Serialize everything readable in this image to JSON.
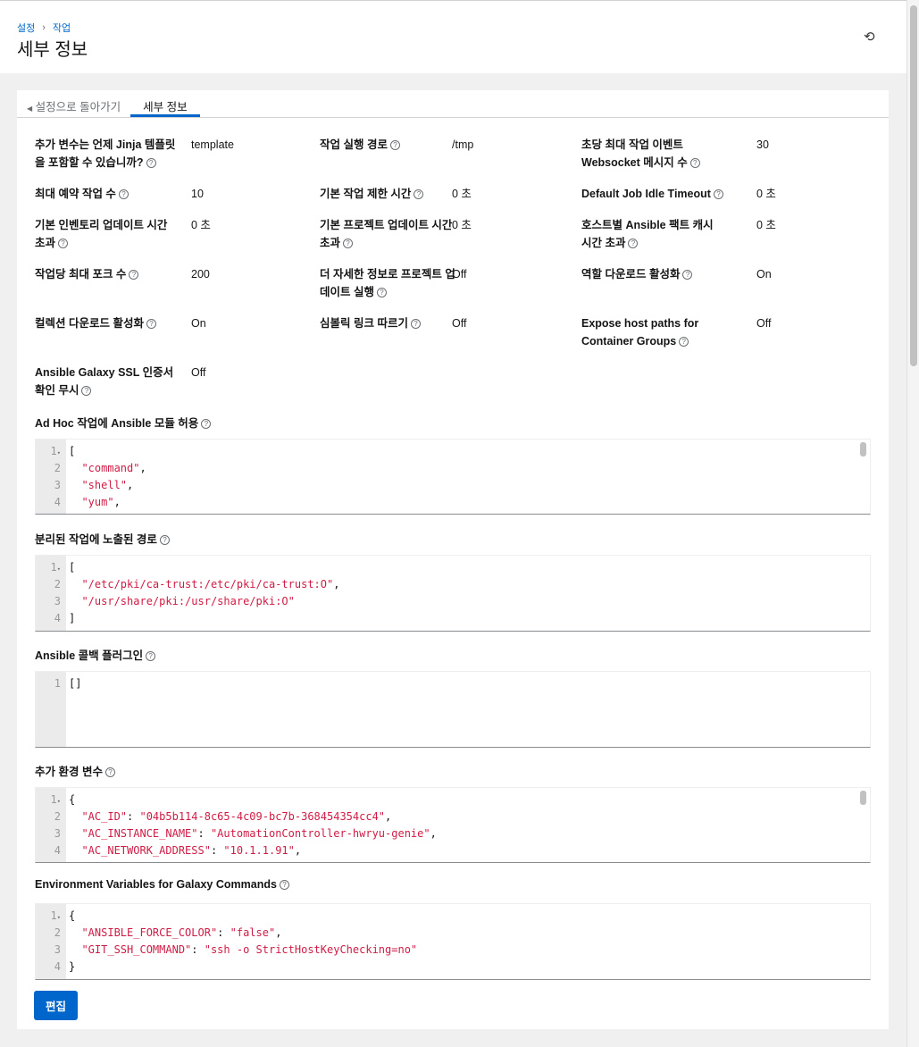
{
  "breadcrumb": [
    "설정",
    "작업"
  ],
  "title": "세부 정보",
  "tabs": {
    "back": "설정으로 돌아가기",
    "details": "세부 정보"
  },
  "fields": [
    {
      "label": "추가 변수는 언제 Jinja 템플릿을 포함할 수 있습니까?",
      "value": "template"
    },
    {
      "label": "작업 실행 경로",
      "value": "/tmp"
    },
    {
      "label": "초당 최대 작업 이벤트 Websocket 메시지 수",
      "value": "30"
    },
    {
      "label": "최대 예약 작업 수",
      "value": "10"
    },
    {
      "label": "기본 작업 제한 시간",
      "value": "0 초"
    },
    {
      "label": "Default Job Idle Timeout",
      "value": "0 초"
    },
    {
      "label": "기본 인벤토리 업데이트 시간 초과",
      "value": "0 초"
    },
    {
      "label": "기본 프로젝트 업데이트 시간 초과",
      "value": "0 초"
    },
    {
      "label": "호스트별 Ansible 팩트 캐시 시간 초과",
      "value": "0 초"
    },
    {
      "label": "작업당 최대 포크 수",
      "value": "200"
    },
    {
      "label": "더 자세한 정보로 프로젝트 업데이트 실행",
      "value": "Off"
    },
    {
      "label": "역할 다운로드 활성화",
      "value": "On"
    },
    {
      "label": "컬렉션 다운로드 활성화",
      "value": "On"
    },
    {
      "label": "심볼릭 링크 따르기",
      "value": "Off"
    },
    {
      "label": "Expose host paths for Container Groups",
      "value": "Off"
    },
    {
      "label": "Ansible Galaxy SSL 인증서 확인 무시",
      "value": "Off"
    }
  ],
  "editors": [
    {
      "label": "Ad Hoc 작업에 Ansible 모듈 허용",
      "lines": [
        "[",
        "  \"command\",",
        "  \"shell\",",
        "  \"yum\","
      ]
    },
    {
      "label": "분리된 작업에 노출된 경로",
      "lines": [
        "[",
        "  \"/etc/pki/ca-trust:/etc/pki/ca-trust:O\",",
        "  \"/usr/share/pki:/usr/share/pki:O\"",
        "]"
      ]
    },
    {
      "label": "Ansible 콜백 플러그인",
      "lines": [
        "[]"
      ]
    },
    {
      "label": "추가 환경 변수",
      "lines": [
        "{",
        "  \"AC_ID\": \"04b5b114-8c65-4c09-bc7b-368454354cc4\",",
        "  \"AC_INSTANCE_NAME\": \"AutomationController-hwryu-genie\",",
        "  \"AC_NETWORK_ADDRESS\": \"10.1.1.91\","
      ]
    },
    {
      "label": "Environment Variables for Galaxy Commands",
      "lines": [
        "{",
        "  \"ANSIBLE_FORCE_COLOR\": \"false\",",
        "  \"GIT_SSH_COMMAND\": \"ssh -o StrictHostKeyChecking=no\"",
        "}"
      ]
    }
  ],
  "edit_button": "편집"
}
